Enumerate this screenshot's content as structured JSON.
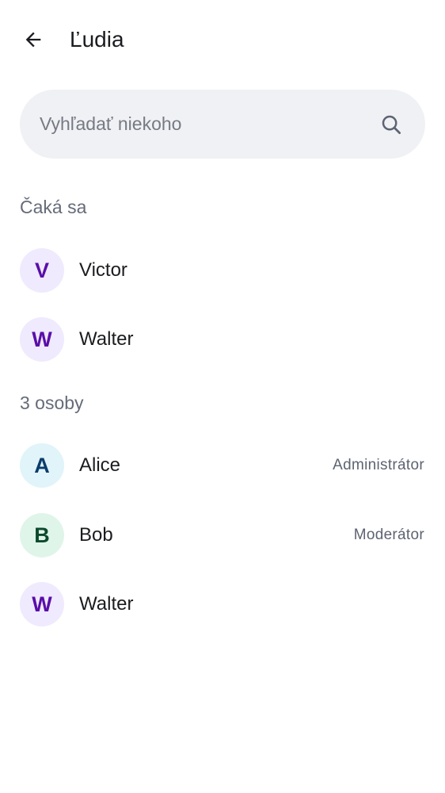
{
  "header": {
    "title": "Ľudia",
    "back_icon": "arrow-back-icon"
  },
  "search": {
    "placeholder": "Vyhľadať niekoho",
    "value": "",
    "icon": "search-icon"
  },
  "pending": {
    "label": "Čaká sa",
    "members": [
      {
        "initial": "V",
        "name": "Victor",
        "role": ""
      },
      {
        "initial": "W",
        "name": "Walter",
        "role": ""
      }
    ]
  },
  "joined": {
    "label": "3 osoby",
    "members": [
      {
        "initial": "A",
        "name": "Alice",
        "role": "Administrátor"
      },
      {
        "initial": "B",
        "name": "Bob",
        "role": "Moderátor"
      },
      {
        "initial": "W",
        "name": "Walter",
        "role": ""
      }
    ]
  },
  "colors": {
    "avatar_purple_bg": "#efeafd",
    "avatar_purple_fg": "#5a0ea8",
    "avatar_blue_bg": "#e0f4fa",
    "avatar_blue_fg": "#0b3c6b",
    "avatar_green_bg": "#e0f5ea",
    "avatar_green_fg": "#0b4a2c",
    "search_bg": "#f0f1f4"
  }
}
